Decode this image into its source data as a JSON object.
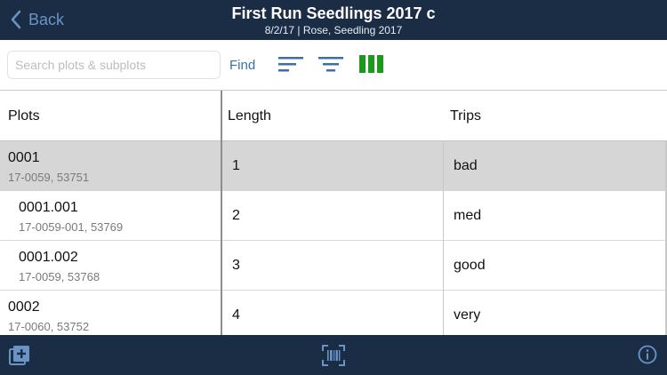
{
  "nav": {
    "back_label": "Back",
    "title": "First Run Seedlings 2017 c",
    "subtitle": "8/2/17 | Rose, Seedling 2017"
  },
  "toolbar": {
    "search_placeholder": "Search plots & subplots",
    "find_label": "Find",
    "icons": [
      "sort-icon",
      "filter-icon",
      "columns-icon"
    ]
  },
  "table": {
    "headers": {
      "plots": "Plots",
      "length": "Length",
      "trips": "Trips"
    },
    "rows": [
      {
        "plot": "0001",
        "sub": "17-0059, 53751",
        "length": "1",
        "trips": "bad",
        "selected": true,
        "indent": false
      },
      {
        "plot": "0001.001",
        "sub": "17-0059-001, 53769",
        "length": "2",
        "trips": "med",
        "selected": false,
        "indent": true
      },
      {
        "plot": "0001.002",
        "sub": "17-0059, 53768",
        "length": "3",
        "trips": "good",
        "selected": false,
        "indent": true
      },
      {
        "plot": "0002",
        "sub": "17-0060, 53752",
        "length": "4",
        "trips": "very",
        "selected": false,
        "indent": false
      }
    ]
  },
  "bottom": {
    "icons": [
      "add-plot-icon",
      "barcode-scan-icon",
      "info-icon"
    ]
  },
  "colors": {
    "nav_bg": "#1b2d45",
    "accent": "#3d6ea6",
    "columns_icon": "#1a9a1a",
    "selected_row": "#d6d6d6"
  }
}
